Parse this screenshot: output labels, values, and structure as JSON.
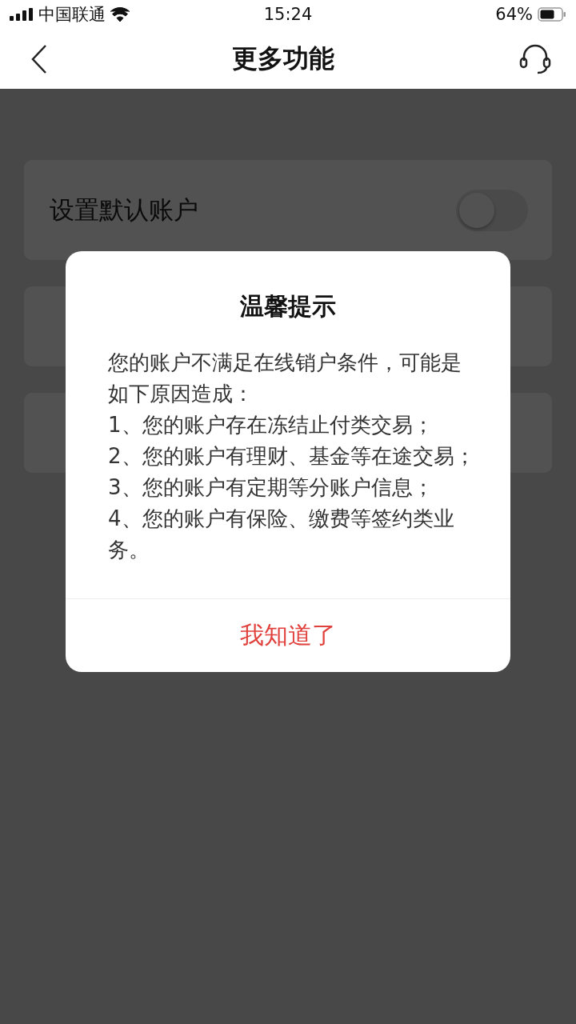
{
  "status_bar": {
    "carrier": "中国联通",
    "time": "15:24",
    "battery": "64%"
  },
  "header": {
    "title": "更多功能"
  },
  "rows": [
    {
      "label": "设置默认账户",
      "kind": "toggle",
      "on": false
    },
    {
      "kind": "plain"
    },
    {
      "kind": "plain"
    }
  ],
  "dialog": {
    "title": "温馨提示",
    "intro": "您的账户不满足在线销户条件，可能是如下原因造成：",
    "items": [
      "1、您的账户存在冻结止付类交易；",
      "2、您的账户有理财、基金等在途交易；",
      "3、您的账户有定期等分账户信息；",
      "4、您的账户有保险、缴费等签约类业务。"
    ],
    "button": "我知道了"
  }
}
